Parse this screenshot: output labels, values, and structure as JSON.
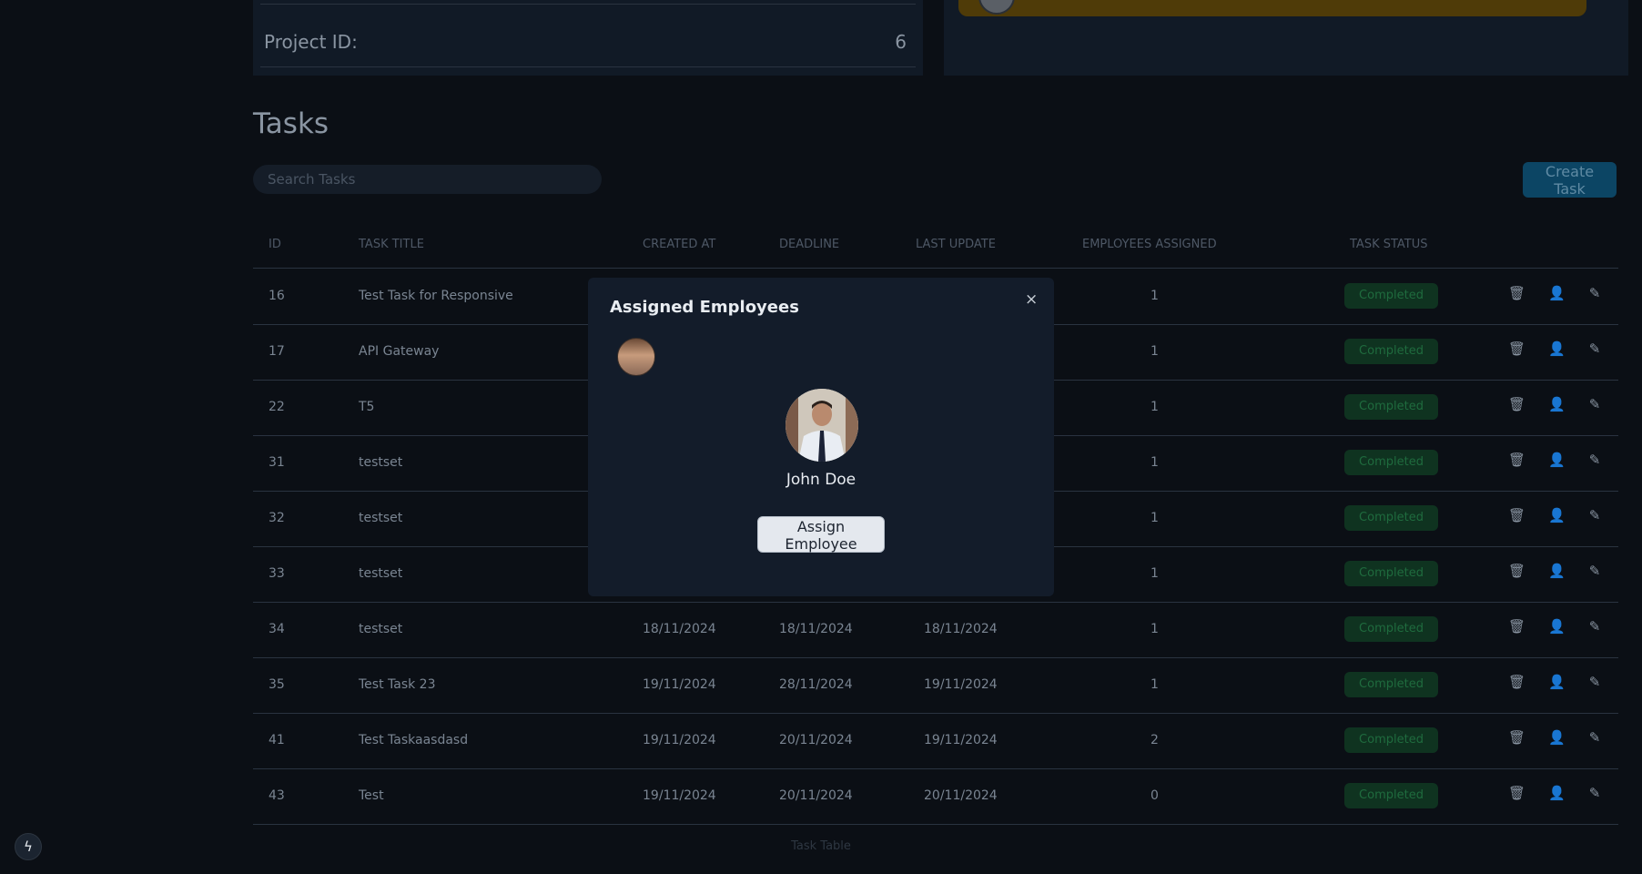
{
  "project": {
    "id_label": "Project ID:",
    "id_value": "6"
  },
  "tasks": {
    "title": "Tasks",
    "search_placeholder": "Search Tasks",
    "create_label": "Create Task",
    "columns": {
      "id": "ID",
      "title": "TASK TITLE",
      "created": "CREATED AT",
      "deadline": "DEADLINE",
      "updated": "LAST UPDATE",
      "employees": "EMPLOYEES ASSIGNED",
      "status": "TASK STATUS"
    },
    "rows": [
      {
        "id": "16",
        "title": "Test Task for Responsive",
        "created": "",
        "deadline": "",
        "updated": "",
        "employees": "1",
        "status": "Completed"
      },
      {
        "id": "17",
        "title": "API Gateway",
        "created": "",
        "deadline": "",
        "updated": "",
        "employees": "1",
        "status": "Completed"
      },
      {
        "id": "22",
        "title": "T5",
        "created": "",
        "deadline": "",
        "updated": "",
        "employees": "1",
        "status": "Completed"
      },
      {
        "id": "31",
        "title": "testset",
        "created": "",
        "deadline": "",
        "updated": "",
        "employees": "1",
        "status": "Completed"
      },
      {
        "id": "32",
        "title": "testset",
        "created": "",
        "deadline": "",
        "updated": "",
        "employees": "1",
        "status": "Completed"
      },
      {
        "id": "33",
        "title": "testset",
        "created": "",
        "deadline": "",
        "updated": "",
        "employees": "1",
        "status": "Completed"
      },
      {
        "id": "34",
        "title": "testset",
        "created": "18/11/2024",
        "deadline": "18/11/2024",
        "updated": "18/11/2024",
        "employees": "1",
        "status": "Completed"
      },
      {
        "id": "35",
        "title": "Test Task 23",
        "created": "19/11/2024",
        "deadline": "28/11/2024",
        "updated": "19/11/2024",
        "employees": "1",
        "status": "Completed"
      },
      {
        "id": "41",
        "title": "Test Taskaasdasd",
        "created": "19/11/2024",
        "deadline": "20/11/2024",
        "updated": "19/11/2024",
        "employees": "2",
        "status": "Completed"
      },
      {
        "id": "43",
        "title": "Test",
        "created": "19/11/2024",
        "deadline": "20/11/2024",
        "updated": "20/11/2024",
        "employees": "0",
        "status": "Completed"
      }
    ],
    "caption": "Task Table"
  },
  "modal": {
    "title": "Assigned Employees",
    "close_label": "×",
    "employee_name": "John Doe",
    "assign_label": "Assign Employee"
  },
  "icons": {
    "delete": "trash-icon",
    "assign": "user-icon",
    "edit": "edit-icon",
    "dev": "bolt-icon"
  },
  "colors": {
    "status_completed_bg": "#0f3320",
    "status_completed_text": "#1f6b3e",
    "create_button": "#0c4564"
  }
}
